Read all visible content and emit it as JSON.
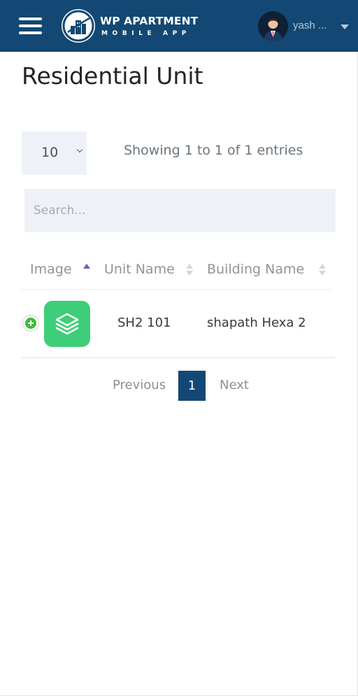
{
  "header": {
    "brand_title": "WP APARTMENT",
    "brand_subtitle": "MOBILE APP",
    "user_name": "yash ..."
  },
  "page": {
    "title": "Residential Unit"
  },
  "table_controls": {
    "page_length": "10",
    "info": "Showing 1 to 1 of 1 entries",
    "search_placeholder": "Search..."
  },
  "table": {
    "columns": [
      "Image",
      "Unit Name",
      "Building Name"
    ],
    "sort": {
      "column": "Image",
      "direction": "ascending"
    },
    "rows": [
      {
        "unit_name": "SH2 101",
        "building_name": "shapath Hexa 2"
      }
    ]
  },
  "pagination": {
    "previous": "Previous",
    "pages": [
      "1"
    ],
    "current_page": "1",
    "next": "Next"
  },
  "colors": {
    "header_bg": "#124873",
    "accent": "#124873",
    "unit_image_bg": "#3ecd78",
    "expand_green": "#3dbc3a"
  },
  "icons": {
    "menu": "hamburger-icon",
    "logo": "building-logo-icon",
    "avatar": "user-avatar",
    "dropdown": "caret-down-icon",
    "unit_image": "layers-icon"
  }
}
